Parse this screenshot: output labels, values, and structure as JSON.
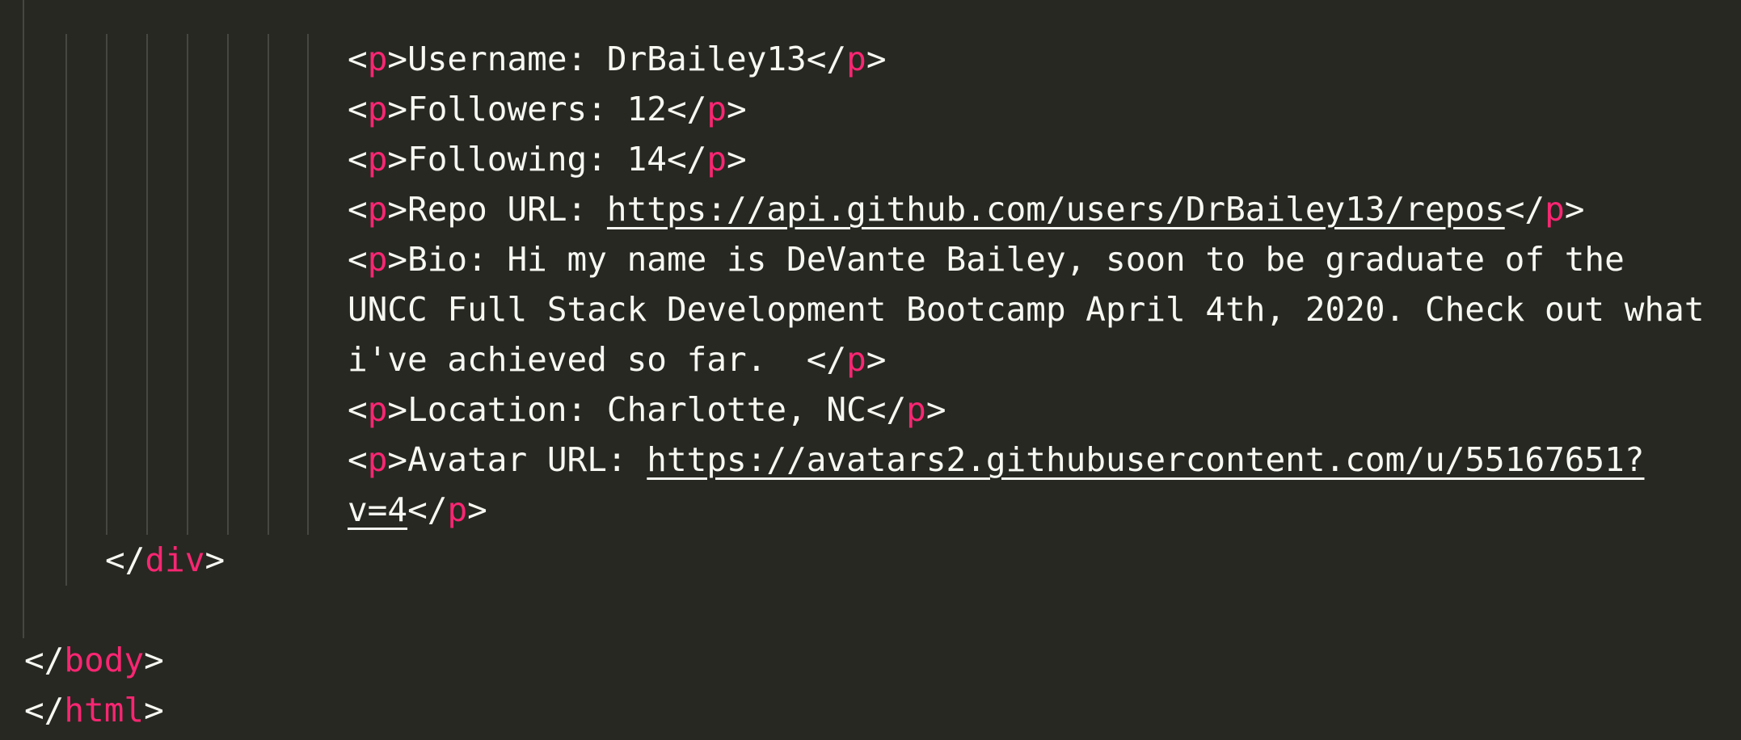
{
  "editor": {
    "theme_colors": {
      "background": "#272822",
      "text": "#f8f8f2",
      "tag": "#f92672",
      "indent_guide": "#464741"
    },
    "lines": {
      "username": {
        "tag": "p",
        "text": "Username: DrBailey13"
      },
      "followers": {
        "tag": "p",
        "text": "Followers: 12"
      },
      "following": {
        "tag": "p",
        "text": "Following: 14"
      },
      "repo": {
        "tag": "p",
        "prefix": "Repo URL: ",
        "url": "https://api.github.com/users/DrBailey13/repos"
      },
      "bio": {
        "tag": "p",
        "line1": "Bio: Hi my name is DeVante Bailey, soon to be graduate of the",
        "line2": "UNCC Full Stack Development Bootcamp April 4th, 2020. Check out what",
        "line3": "i've achieved so far.  "
      },
      "location": {
        "tag": "p",
        "text": "Location: Charlotte, NC"
      },
      "avatar": {
        "tag": "p",
        "prefix": "Avatar URL: ",
        "url_line1": "https://avatars2.githubusercontent.com/u/55167651?",
        "url_line2": "v=4"
      },
      "div_close": {
        "tag": "div"
      },
      "body_close": {
        "tag": "body"
      },
      "html_close": {
        "tag": "html"
      }
    },
    "punctuation": {
      "open": "<",
      "close": ">",
      "open_end": "</"
    }
  }
}
